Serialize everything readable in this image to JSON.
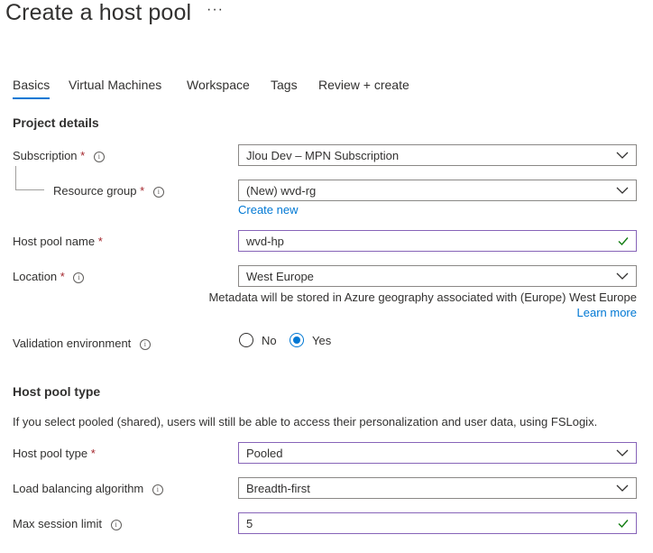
{
  "page": {
    "title": "Create a host pool",
    "more": "···"
  },
  "tabs": [
    {
      "label": "Basics",
      "active": true
    },
    {
      "label": "Virtual Machines"
    },
    {
      "label": "Workspace"
    },
    {
      "label": "Tags"
    },
    {
      "label": "Review + create"
    }
  ],
  "project": {
    "heading": "Project details",
    "subscription": {
      "label": "Subscription",
      "value": "Jlou Dev – MPN Subscription"
    },
    "resource_group": {
      "label": "Resource group",
      "value": "(New) wvd-rg",
      "create_new": "Create new"
    },
    "host_pool_name": {
      "label": "Host pool name",
      "value": "wvd-hp"
    },
    "location": {
      "label": "Location",
      "value": "West Europe",
      "note": "Metadata will be stored in Azure geography associated with (Europe) West Europe",
      "learn_more": "Learn more"
    },
    "validation": {
      "label": "Validation environment",
      "options": [
        "No",
        "Yes"
      ],
      "selected": "Yes"
    }
  },
  "pool_type": {
    "heading": "Host pool type",
    "description": "If you select pooled (shared), users will still be able to access their personalization and user data, using FSLogix.",
    "type": {
      "label": "Host pool type",
      "value": "Pooled"
    },
    "load_balancing": {
      "label": "Load balancing algorithm",
      "value": "Breadth-first"
    },
    "max_session": {
      "label": "Max session limit",
      "value": "5"
    }
  },
  "symbols": {
    "required": "*",
    "info": "i"
  },
  "colors": {
    "accent": "#0078d4",
    "focus_border": "#8764b8",
    "required": "#a4262c",
    "valid": "#107c10"
  }
}
